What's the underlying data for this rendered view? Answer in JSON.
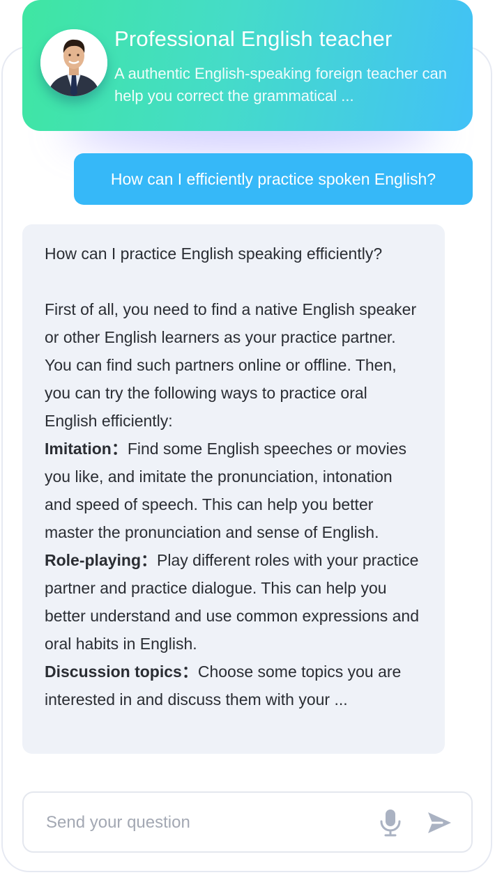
{
  "header": {
    "title": "Professional English teacher",
    "description": "A authentic English-speaking foreign teacher can help you correct the grammatical ..."
  },
  "conversation": {
    "user_message": "How can I efficiently practice spoken English?",
    "bot_reply": {
      "question": "How can I practice English speaking efficiently?",
      "intro": "First of all, you need to find a native English speaker or other English learners as your practice partner. You can find such partners online or offline. Then, you can try the following ways to practice oral English efficiently:",
      "methods": [
        {
          "term": "Imitation：",
          "text": "Find some English speeches or movies you like, and imitate the pronunciation, intonation and speed of speech. This can help you better master the pronunciation and sense of English."
        },
        {
          "term": "Role-playing：",
          "text": "Play different roles with your practice partner and practice dialogue. This can help you better understand and use common expressions and oral habits in English."
        },
        {
          "term": "Discussion topics：",
          "text": "Choose some topics you are interested in and discuss them with your ..."
        }
      ]
    }
  },
  "input": {
    "placeholder": "Send your question",
    "value": ""
  },
  "icons": {
    "mic": "microphone-icon",
    "send": "send-icon"
  },
  "colors": {
    "header_gradient_start": "#3fe6a2",
    "header_gradient_end": "#42c1f7",
    "user_bubble": "#36b8f8",
    "bot_bubble": "#eff2f8",
    "icon_gray": "#aab2c2"
  }
}
